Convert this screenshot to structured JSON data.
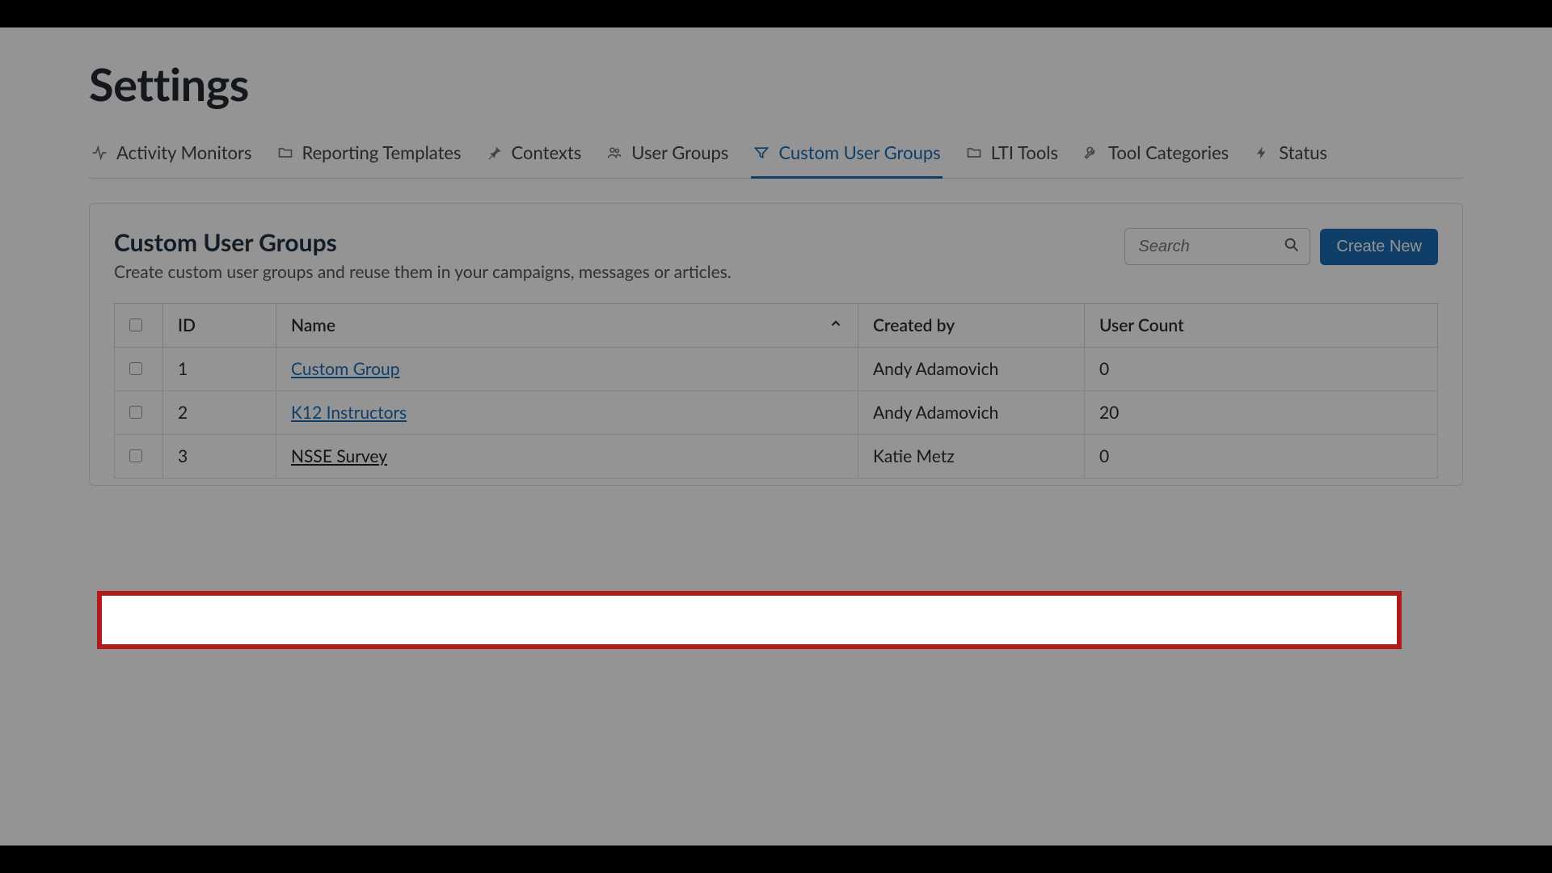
{
  "page": {
    "title": "Settings"
  },
  "tabs": [
    {
      "label": "Activity Monitors",
      "icon": "activity"
    },
    {
      "label": "Reporting Templates",
      "icon": "folder"
    },
    {
      "label": "Contexts",
      "icon": "pin"
    },
    {
      "label": "User Groups",
      "icon": "users"
    },
    {
      "label": "Custom User Groups",
      "icon": "filter",
      "active": true
    },
    {
      "label": "LTI Tools",
      "icon": "folder"
    },
    {
      "label": "Tool Categories",
      "icon": "wrench"
    },
    {
      "label": "Status",
      "icon": "bolt"
    }
  ],
  "panel": {
    "title": "Custom User Groups",
    "subtitle": "Create custom user groups and reuse them in your campaigns, messages or articles."
  },
  "search": {
    "placeholder": "Search"
  },
  "buttons": {
    "create": "Create New"
  },
  "table": {
    "headers": {
      "id": "ID",
      "name": "Name",
      "createdBy": "Created by",
      "userCount": "User Count"
    },
    "rows": [
      {
        "id": "1",
        "name": "Custom Group",
        "createdBy": "Andy Adamovich",
        "userCount": "0",
        "linkStyle": "blue"
      },
      {
        "id": "2",
        "name": "K12 Instructors",
        "createdBy": "Andy Adamovich",
        "userCount": "20",
        "linkStyle": "blue"
      },
      {
        "id": "3",
        "name": "NSSE Survey",
        "createdBy": "Katie Metz",
        "userCount": "0",
        "linkStyle": "dark",
        "highlight": true
      }
    ]
  }
}
